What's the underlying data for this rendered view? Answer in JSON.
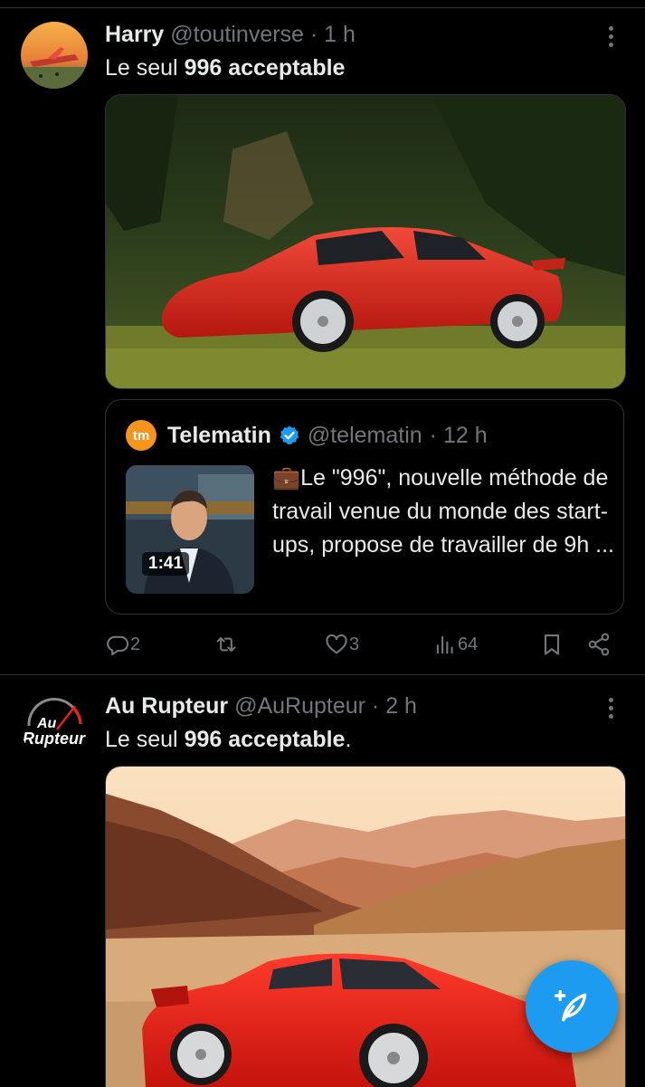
{
  "tweets": [
    {
      "name": "Harry",
      "handle": "@toutinverse",
      "time": "· 1 h",
      "text_prefix": "Le seul ",
      "text_bold": "996 acceptable",
      "text_suffix": "",
      "quote": {
        "name": "Telematin",
        "logo": "tm",
        "handle": "@telematin",
        "time": "· 12 h",
        "video_duration": "1:41",
        "text": "💼Le \"996\", nouvelle méthode de travail venue du monde des start-ups, propose de travailler de 9h ..."
      },
      "actions": {
        "replies": "2",
        "retweets": "",
        "likes": "3",
        "views": "64"
      }
    },
    {
      "name": "Au Rupteur",
      "handle": "@AuRupteur",
      "time": "· 2 h",
      "text_prefix": "Le seul ",
      "text_bold": "996 acceptable",
      "text_suffix": ".",
      "logo_line1": "Au",
      "logo_line2": "Rupteur"
    }
  ],
  "icons": [
    "more-icon",
    "verified-icon",
    "reply-icon",
    "retweet-icon",
    "like-icon",
    "views-icon",
    "bookmark-icon",
    "share-icon",
    "compose-icon"
  ],
  "colors": {
    "background": "#000000",
    "text": "#e7e9ea",
    "muted": "#71767b",
    "accent": "#1d9bf0",
    "border": "#2f3336"
  }
}
